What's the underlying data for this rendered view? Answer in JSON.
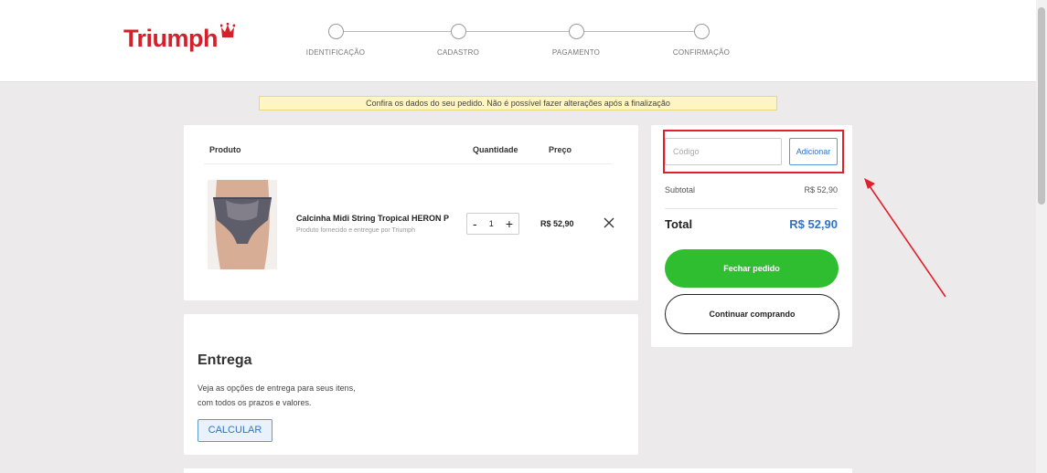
{
  "brand": {
    "name": "Triumph",
    "color": "#d4202a"
  },
  "steps": [
    "IDENTIFICAÇÃO",
    "CADASTRO",
    "PAGAMENTO",
    "CONFIRMAÇÃO"
  ],
  "notice": "Confira os dados do seu pedido. Não é possível fazer alterações após a finalização",
  "cart": {
    "headers": {
      "product": "Produto",
      "quantity": "Quantidade",
      "price": "Preço"
    },
    "item": {
      "name": "Calcinha Midi String Tropical HERON P",
      "seller": "Produto fornecido e entregue por Triumph",
      "minus": "-",
      "quantity": "1",
      "plus": "+",
      "price": "R$ 52,90",
      "image_icon": "product-photo"
    }
  },
  "delivery": {
    "title": "Entrega",
    "description": "Veja as opções de entrega para seus itens,\ncom todos os prazos e valores.",
    "button": "CALCULAR"
  },
  "summary": {
    "coupon_placeholder": "Código",
    "coupon_button": "Adicionar",
    "subtotal_label": "Subtotal",
    "subtotal_value": "R$ 52,90",
    "total_label": "Total",
    "total_value": "R$ 52,90",
    "checkout_button": "Fechar pedido",
    "continue_button": "Continuar comprando"
  },
  "colors": {
    "accent_blue": "#2f73c9",
    "checkout_green": "#2fbe30",
    "highlight_red": "#e0202a"
  }
}
